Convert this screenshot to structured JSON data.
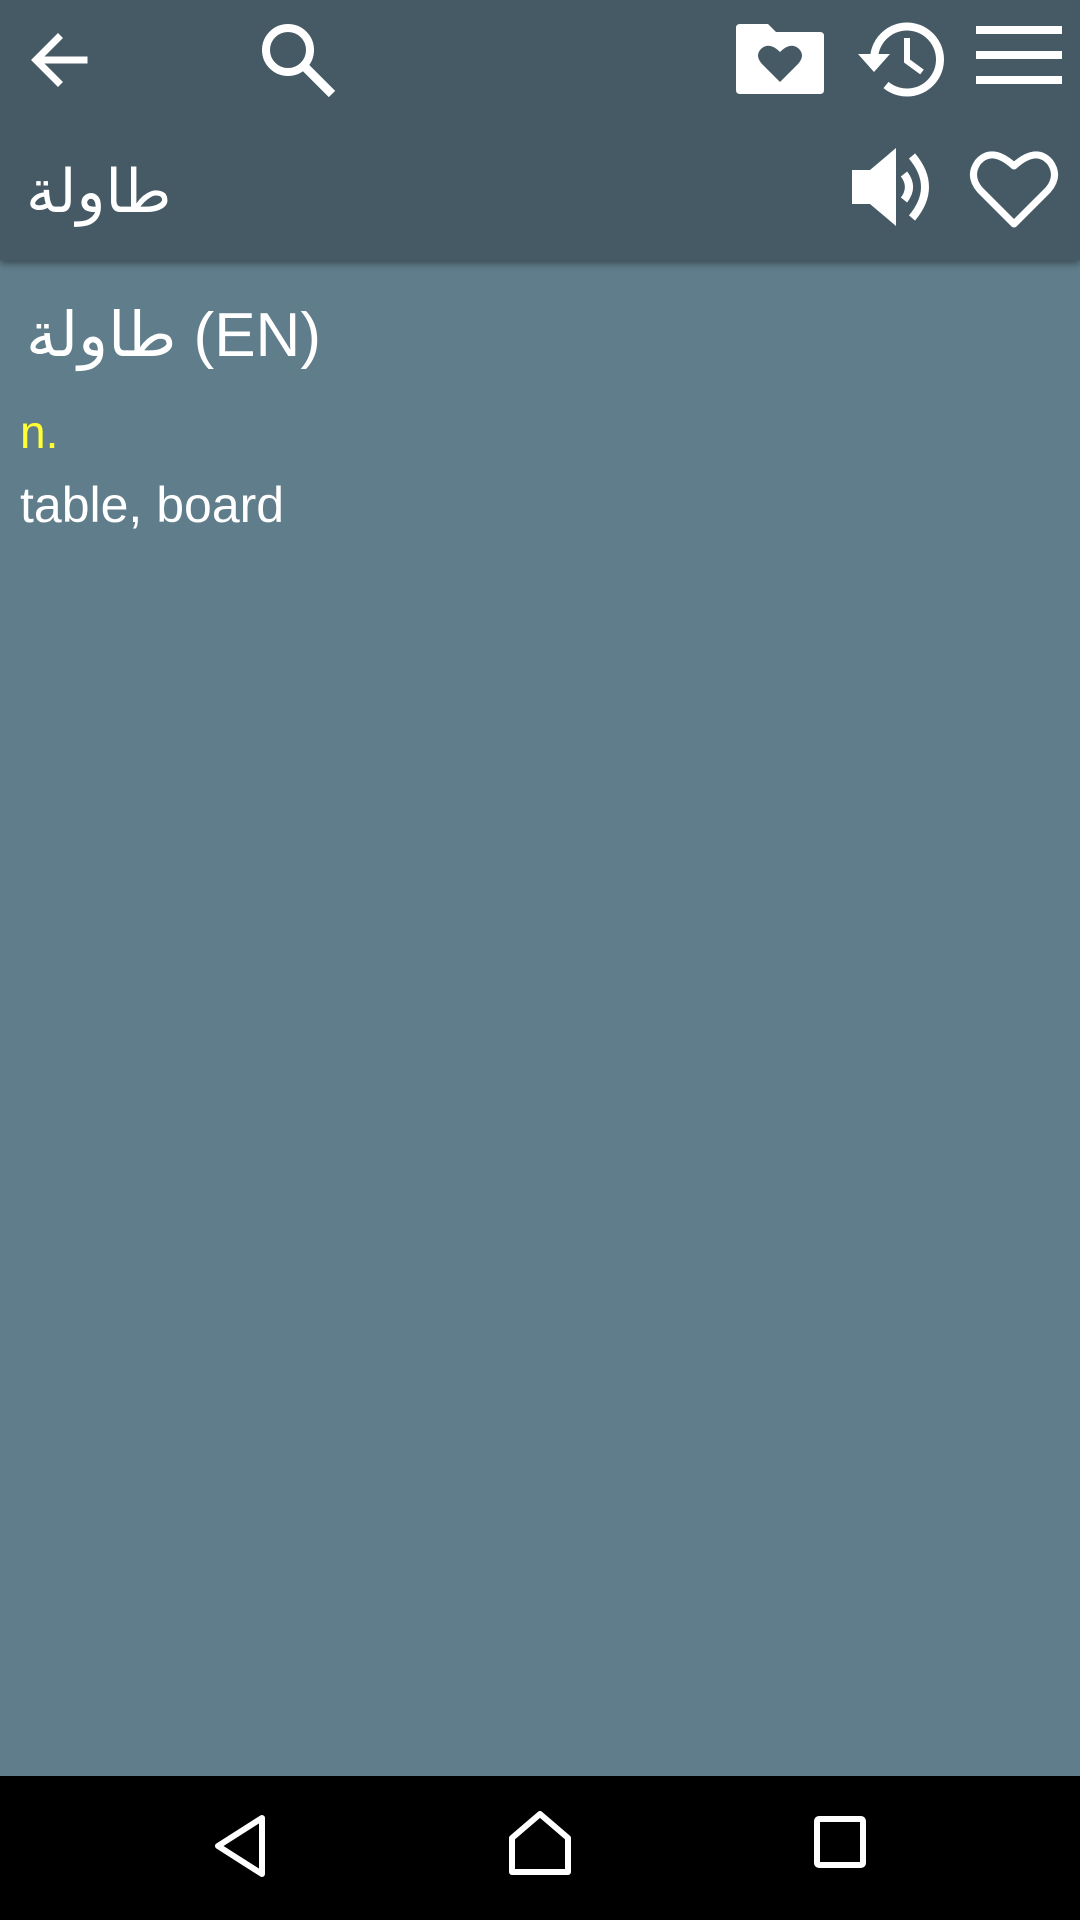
{
  "toolbar": {
    "icons": [
      "back-arrow-icon",
      "search-icon",
      "favorites-folder-icon",
      "history-icon",
      "menu-icon"
    ]
  },
  "word_bar": {
    "word": "طاولة",
    "icons": [
      "speaker-icon",
      "heart-outline-icon"
    ]
  },
  "entry": {
    "word": "طاولة",
    "language": "(EN)",
    "part_of_speech": "n.",
    "definition": "table, board"
  },
  "colors": {
    "toolbar_bg": "#455a64",
    "content_bg": "#607d8b",
    "part_of_speech": "#ffff33",
    "text": "#ffffff",
    "navbar_bg": "#000000"
  },
  "navbar": {
    "icons": [
      "nav-back-icon",
      "nav-home-icon",
      "nav-recents-icon"
    ]
  }
}
